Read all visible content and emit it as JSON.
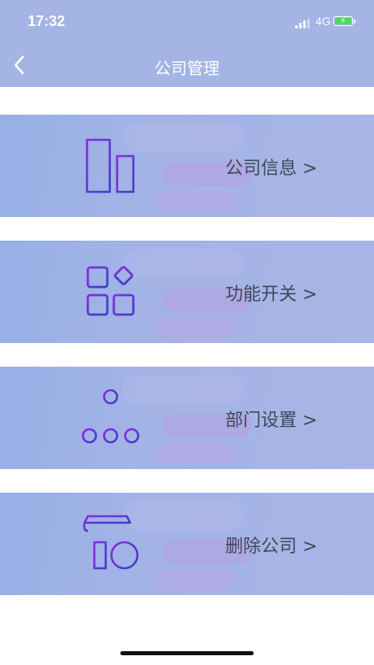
{
  "status": {
    "time": "17:32",
    "network": "4G"
  },
  "nav": {
    "title": "公司管理"
  },
  "menu": [
    {
      "label": "公司信息 >",
      "icon": "building-icon"
    },
    {
      "label": "功能开关 >",
      "icon": "apps-grid-icon"
    },
    {
      "label": "部门设置 >",
      "icon": "org-chart-icon"
    },
    {
      "label": "删除公司 >",
      "icon": "store-remove-icon"
    }
  ],
  "colors": {
    "header": "#a3b4e5",
    "icon_gradient": [
      "#8a2be2",
      "#3b3fc4"
    ]
  }
}
